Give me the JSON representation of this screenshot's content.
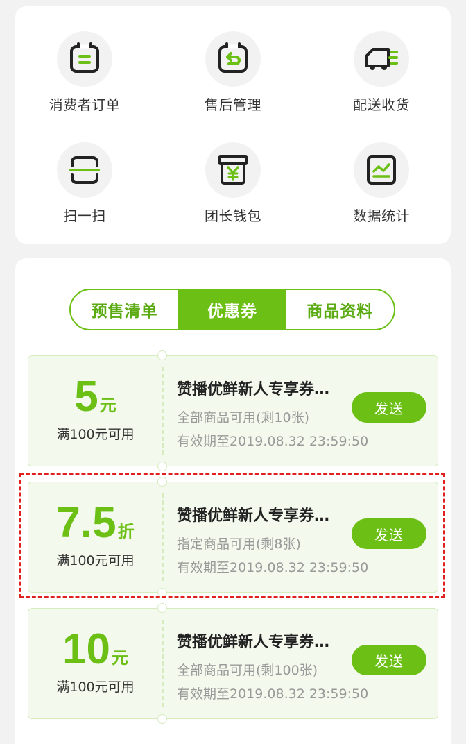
{
  "shortcuts": [
    {
      "label": "消费者订单",
      "icon": "order-list-icon"
    },
    {
      "label": "售后管理",
      "icon": "return-icon"
    },
    {
      "label": "配送收货",
      "icon": "delivery-truck-icon"
    },
    {
      "label": "扫一扫",
      "icon": "scan-icon"
    },
    {
      "label": "团长钱包",
      "icon": "wallet-yen-icon"
    },
    {
      "label": "数据统计",
      "icon": "stats-chart-icon"
    }
  ],
  "tabs": [
    {
      "label": "预售清单",
      "active": false
    },
    {
      "label": "优惠券",
      "active": true
    },
    {
      "label": "商品资料",
      "active": false
    }
  ],
  "coupons": [
    {
      "value": "5",
      "unit": "元",
      "condition": "满100元可用",
      "title": "赞播优鲜新人专享券…",
      "scope": "全部商品可用(剩10张)",
      "validity": "有效期至2019.08.32  23:59:50",
      "send_label": "发送"
    },
    {
      "value": "7.5",
      "unit": "折",
      "condition": "满100元可用",
      "title": "赞播优鲜新人专享券…",
      "scope": "指定商品可用(剩8张)",
      "validity": "有效期至2019.08.32  23:59:50",
      "send_label": "发送",
      "highlighted": true
    },
    {
      "value": "10",
      "unit": "元",
      "condition": "满100元可用",
      "title": "赞播优鲜新人专享券…",
      "scope": "全部商品可用(剩100张)",
      "validity": "有效期至2019.08.32  23:59:50",
      "send_label": "发送"
    }
  ],
  "colors": {
    "accent": "#6bbf15",
    "coupon_bg": "#f3f9ec",
    "highlight": "#e0201e",
    "page_bg": "#f2f2f2"
  }
}
